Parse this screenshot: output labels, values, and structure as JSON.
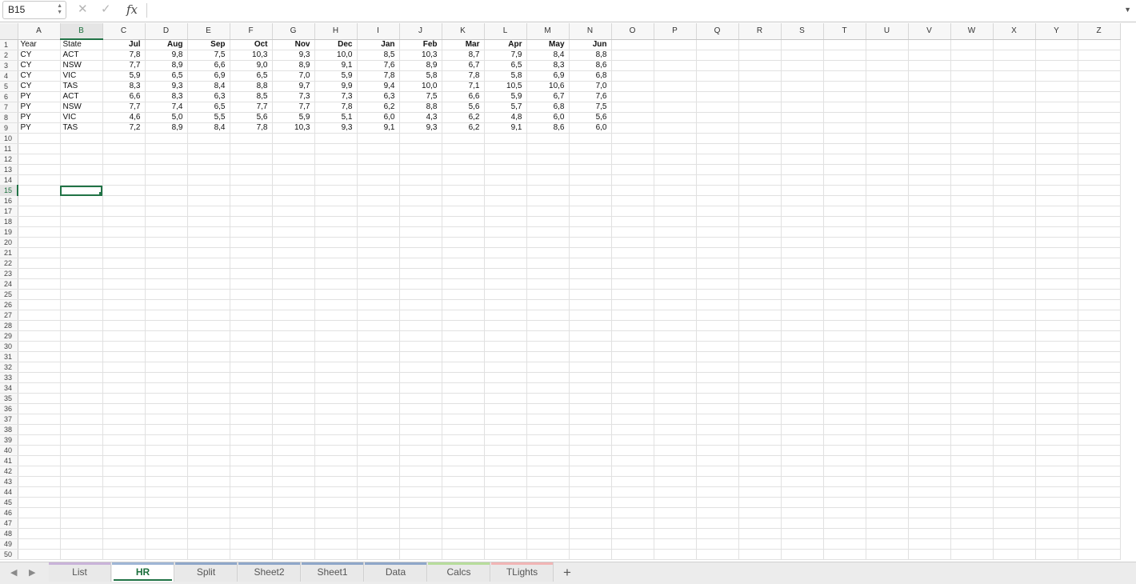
{
  "formula_bar": {
    "name_box": "B15",
    "cancel_glyph": "✕",
    "confirm_glyph": "✓",
    "fx_label": "fx",
    "formula_value": ""
  },
  "icons": {
    "namebox_spinner": "up-down-arrows-icon",
    "expand": "chevron-down-icon",
    "prev_sheet": "chevron-left-icon",
    "next_sheet": "chevron-right-icon",
    "add_sheet": "plus-icon"
  },
  "columns": [
    "A",
    "B",
    "C",
    "D",
    "E",
    "F",
    "G",
    "H",
    "I",
    "J",
    "K",
    "L",
    "M",
    "N",
    "O",
    "P",
    "Q",
    "R",
    "S",
    "T",
    "U",
    "V",
    "W",
    "X",
    "Y",
    "Z"
  ],
  "row_count": 50,
  "selected": {
    "column": "B",
    "row": 15
  },
  "header_row": [
    "Year",
    "State",
    "Jul",
    "Aug",
    "Sep",
    "Oct",
    "Nov",
    "Dec",
    "Jan",
    "Feb",
    "Mar",
    "Apr",
    "May",
    "Jun"
  ],
  "data_rows": [
    [
      "CY",
      "ACT",
      "7,8",
      "9,8",
      "7,5",
      "10,3",
      "9,3",
      "10,0",
      "8,5",
      "10,3",
      "8,7",
      "7,9",
      "8,4",
      "8,8"
    ],
    [
      "CY",
      "NSW",
      "7,7",
      "8,9",
      "6,6",
      "9,0",
      "8,9",
      "9,1",
      "7,6",
      "8,9",
      "6,7",
      "6,5",
      "8,3",
      "8,6"
    ],
    [
      "CY",
      "VIC",
      "5,9",
      "6,5",
      "6,9",
      "6,5",
      "7,0",
      "5,9",
      "7,8",
      "5,8",
      "7,8",
      "5,8",
      "6,9",
      "6,8"
    ],
    [
      "CY",
      "TAS",
      "8,3",
      "9,3",
      "8,4",
      "8,8",
      "9,7",
      "9,9",
      "9,4",
      "10,0",
      "7,1",
      "10,5",
      "10,6",
      "7,0"
    ],
    [
      "PY",
      "ACT",
      "6,6",
      "8,3",
      "6,3",
      "8,5",
      "7,3",
      "7,3",
      "6,3",
      "7,5",
      "6,6",
      "5,9",
      "6,7",
      "7,6"
    ],
    [
      "PY",
      "NSW",
      "7,7",
      "7,4",
      "6,5",
      "7,7",
      "7,7",
      "7,8",
      "6,2",
      "8,8",
      "5,6",
      "5,7",
      "6,8",
      "7,5"
    ],
    [
      "PY",
      "VIC",
      "4,6",
      "5,0",
      "5,5",
      "5,6",
      "5,9",
      "5,1",
      "6,0",
      "4,3",
      "6,2",
      "4,8",
      "6,0",
      "5,6"
    ],
    [
      "PY",
      "TAS",
      "7,2",
      "8,9",
      "8,4",
      "7,8",
      "10,3",
      "9,3",
      "9,1",
      "9,3",
      "6,2",
      "9,1",
      "8,6",
      "6,0"
    ]
  ],
  "sheet_tabs": [
    {
      "label": "List",
      "color": "#c9b3d9",
      "active": false
    },
    {
      "label": "HR",
      "color": "#9fb6d6",
      "active": true
    },
    {
      "label": "Split",
      "color": "#8fa7c9",
      "active": false
    },
    {
      "label": "Sheet2",
      "color": "#8fa7c9",
      "active": false
    },
    {
      "label": "Sheet1",
      "color": "#8fa7c9",
      "active": false
    },
    {
      "label": "Data",
      "color": "#8fa7c9",
      "active": false
    },
    {
      "label": "Calcs",
      "color": "#b7dd9c",
      "active": false
    },
    {
      "label": "TLights",
      "color": "#f1b5b5",
      "active": false
    }
  ],
  "add_sheet_label": "+"
}
